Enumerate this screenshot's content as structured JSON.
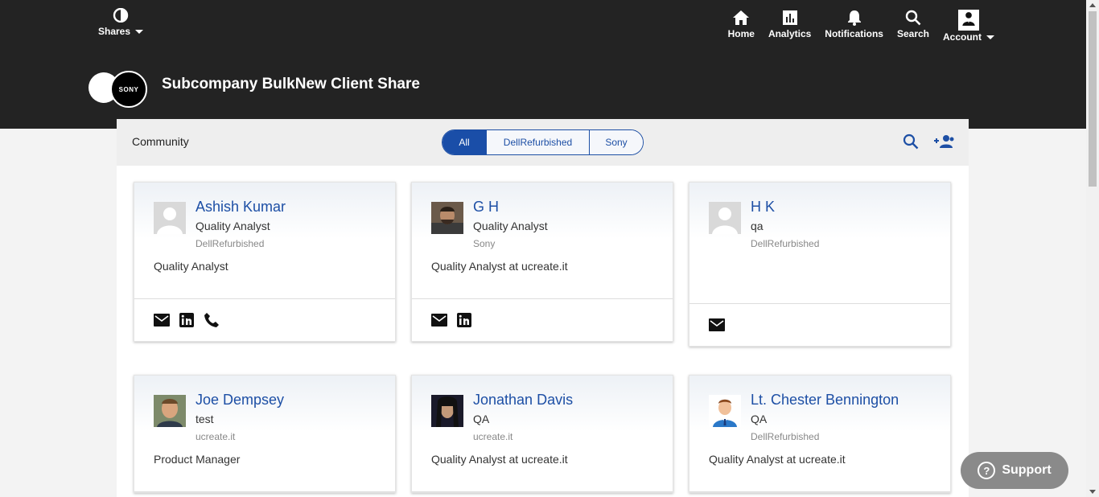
{
  "header": {
    "shares_label": "Shares",
    "nav": [
      {
        "label": "Home",
        "icon": "home-icon"
      },
      {
        "label": "Analytics",
        "icon": "analytics-icon"
      },
      {
        "label": "Notifications",
        "icon": "bell-icon"
      },
      {
        "label": "Search",
        "icon": "search-icon"
      },
      {
        "label": "Account",
        "icon": "account-avatar"
      }
    ],
    "share_logo_text": "SONY",
    "share_title": "Subcompany BulkNew Client Share"
  },
  "community": {
    "title": "Community",
    "filters": [
      {
        "label": "All",
        "active": true
      },
      {
        "label": "DellRefurbished",
        "active": false
      },
      {
        "label": "Sony",
        "active": false
      }
    ]
  },
  "members": [
    {
      "name": "Ashish Kumar",
      "role": "Quality Analyst",
      "org": "DellRefurbished",
      "bio": "Quality Analyst",
      "contacts": [
        "mail-icon",
        "linkedin-icon",
        "phone-icon"
      ]
    },
    {
      "name": "G H",
      "role": "Quality Analyst",
      "org": "Sony",
      "bio": "Quality Analyst at ucreate.it",
      "contacts": [
        "mail-icon",
        "linkedin-icon"
      ]
    },
    {
      "name": "H K",
      "role": "qa",
      "org": "DellRefurbished",
      "bio": "",
      "contacts": [
        "mail-icon"
      ]
    },
    {
      "name": "Joe Dempsey",
      "role": "test",
      "org": "ucreate.it",
      "bio": "Product Manager",
      "contacts": []
    },
    {
      "name": "Jonathan Davis",
      "role": "QA",
      "org": "ucreate.it",
      "bio": "Quality Analyst at ucreate.it",
      "contacts": []
    },
    {
      "name": "Lt. Chester Bennington",
      "role": "QA",
      "org": "DellRefurbished",
      "bio": "Quality Analyst at ucreate.it",
      "contacts": []
    }
  ],
  "support": {
    "label": "Support",
    "icon_text": "?"
  },
  "colors": {
    "header_bg": "#232323",
    "accent": "#1d4fa5",
    "support_bg": "#8a8a8a"
  }
}
